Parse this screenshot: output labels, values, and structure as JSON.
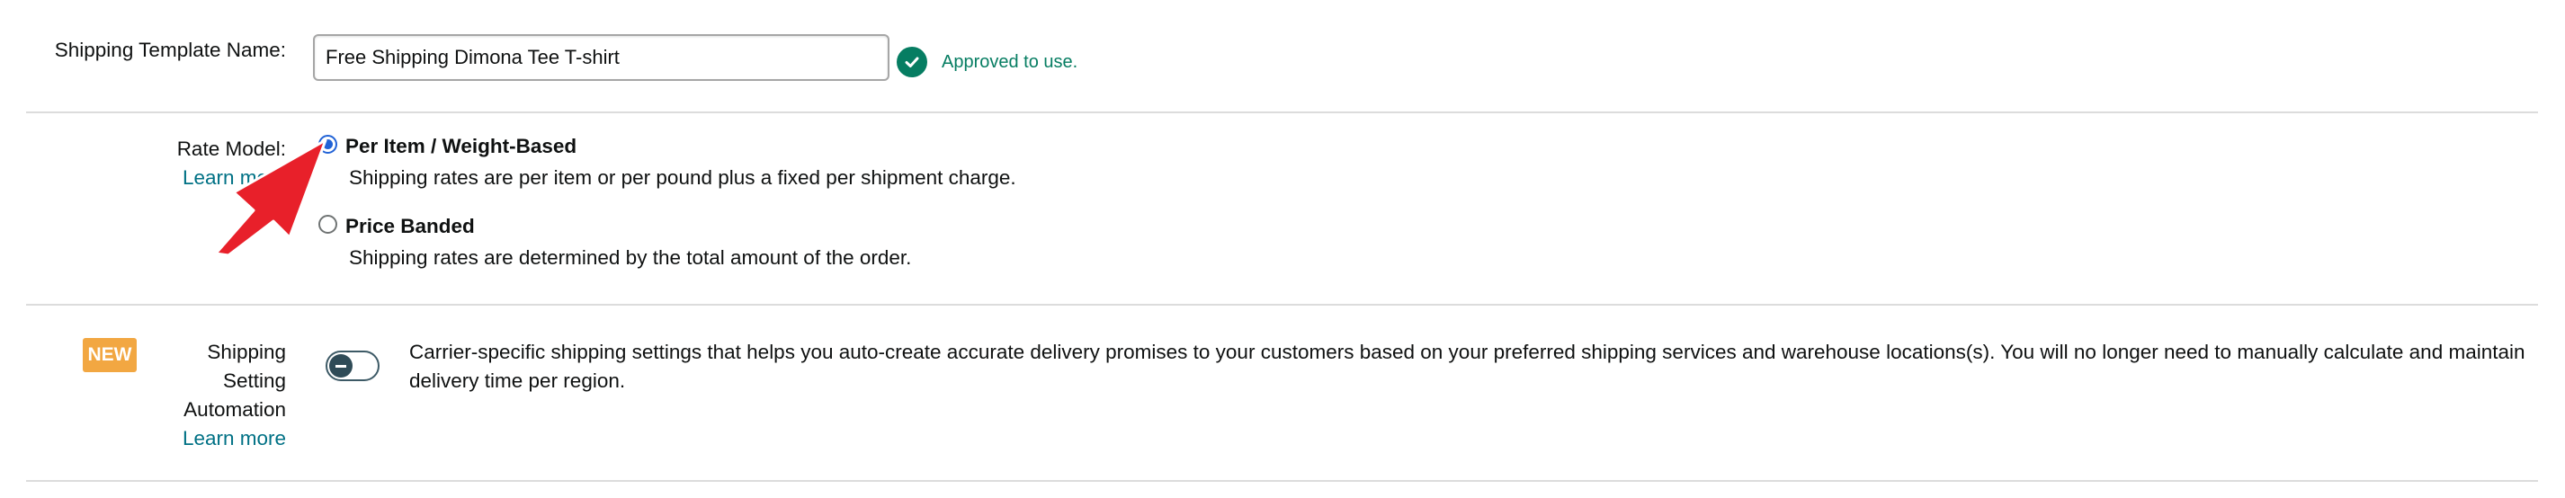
{
  "template_name": {
    "label": "Shipping Template Name:",
    "value": "Free Shipping Dimona Tee T-shirt",
    "status": "Approved to use."
  },
  "rate_model": {
    "label": "Rate Model:",
    "learn_more": "Learn more",
    "options": [
      {
        "title": "Per Item / Weight-Based",
        "description": "Shipping rates are per item or per pound plus a fixed per shipment charge.",
        "selected": true
      },
      {
        "title": "Price Banded",
        "description": "Shipping rates are determined by the total amount of the order.",
        "selected": false
      }
    ]
  },
  "automation": {
    "badge": "NEW",
    "label_line1": "Shipping",
    "label_line2": "Setting",
    "label_line3": "Automation",
    "learn_more": "Learn more",
    "enabled": false,
    "description": "Carrier-specific shipping settings that helps you auto-create accurate delivery promises to your customers based on your preferred shipping services and warehouse locations(s). You will no longer need to manually calculate and maintain delivery time per region."
  },
  "colors": {
    "link": "#007185",
    "approved": "#067d62",
    "radio_selected": "#2162d6",
    "badge": "#f2a742",
    "annotation_arrow": "#e8202a"
  }
}
